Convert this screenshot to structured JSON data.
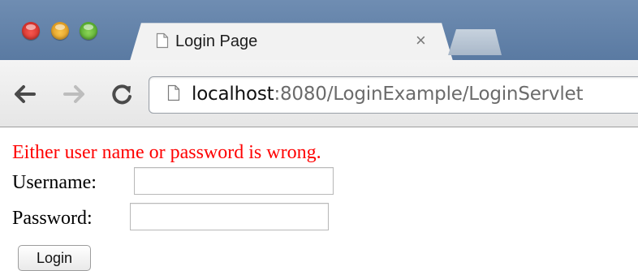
{
  "browser": {
    "tab": {
      "title": "Login Page",
      "close_glyph": "×",
      "favicon": "page-icon"
    },
    "new_tab": "new-tab-button",
    "toolbar": {
      "back_icon": "arrow-left-icon",
      "forward_icon": "arrow-right-icon",
      "reload_icon": "reload-icon"
    },
    "address": {
      "host": "localhost",
      "path": ":8080/LoginExample/LoginServlet",
      "icon": "page-icon"
    },
    "colors": {
      "titlebar": "#6f8db2",
      "error_text": "#ff0000"
    }
  },
  "page": {
    "error_message": "Either user name or password is wrong.",
    "username_label": "Username:",
    "username_value": "",
    "password_label": "Password:",
    "password_value": "",
    "login_button": "Login"
  }
}
